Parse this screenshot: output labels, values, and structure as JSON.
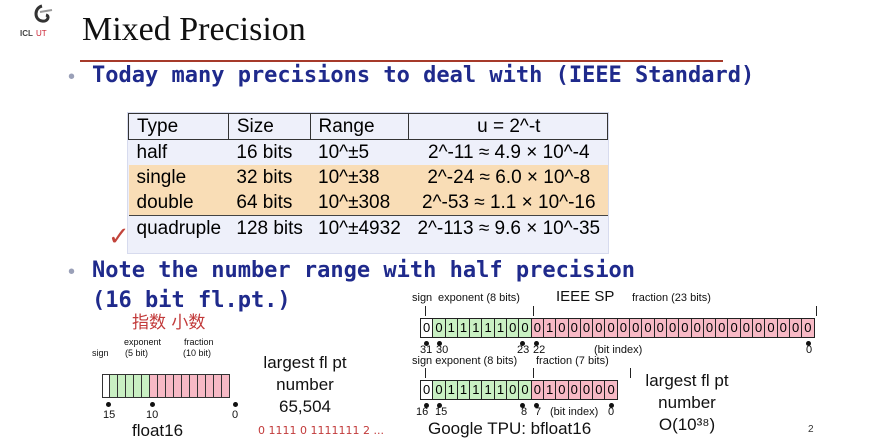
{
  "header": {
    "title": "Mixed Precision"
  },
  "bullets": {
    "b1": "Today many precisions to deal with (IEEE Standard)",
    "b2_line1": "Note the number range with half precision",
    "b2_line2": "(16 bit fl.pt.)"
  },
  "table": {
    "headers": [
      "Type",
      "Size",
      "Range",
      "u = 2^-t"
    ],
    "rows": [
      {
        "type": "half",
        "size": "16 bits",
        "range": "10^±5",
        "u": "2^-11 ≈ 4.9 × 10^-4"
      },
      {
        "type": "single",
        "size": "32 bits",
        "range": "10^±38",
        "u": "2^-24 ≈ 6.0 × 10^-8"
      },
      {
        "type": "double",
        "size": "64 bits",
        "range": "10^±308",
        "u": "2^-53 ≈ 1.1 × 10^-16"
      },
      {
        "type": "quadruple",
        "size": "128 bits",
        "range": "10^±4932",
        "u": "2^-113 ≈ 9.6 × 10^-35"
      }
    ]
  },
  "ieee_sp": {
    "label": "IEEE SP",
    "sign": "sign",
    "exponent": "exponent (8 bits)",
    "fraction": "fraction (23 bits)",
    "bits": "00111110001000000000000000000000",
    "idx_31": "31",
    "idx_30": "30",
    "idx_23": "23",
    "idx_22": "22",
    "idx_0": "0",
    "bit_index": "(bit index)"
  },
  "bfloat16": {
    "sign_exp": "sign  exponent (8 bits)",
    "fraction": "fraction (7 bits)",
    "bits": "0011111000100000",
    "idx_16": "16",
    "idx_15": "15",
    "idx_8": "8",
    "idx_7": "7",
    "idx_0": "0",
    "bit_index": "(bit index)",
    "caption": "Google TPU: bfloat16"
  },
  "float16": {
    "exponent": "exponent",
    "exponent_bits": "(5 bit)",
    "fraction": "fraction",
    "fraction_bits": "(10 bit)",
    "sign": "sign",
    "idx_15": "15",
    "idx_10": "10",
    "idx_0": "0",
    "caption": "float16",
    "largest_line1": "largest fl pt",
    "largest_line2": "number",
    "largest_value": "65,504"
  },
  "bf16_largest": {
    "line1": "largest fl pt",
    "line2": "number",
    "value": "O(10³⁸)"
  },
  "handwriting": {
    "h1": "指数 小数",
    "h2": "0 1111 0 1111111 2 ..."
  },
  "colors": {
    "bullet": "#1f2a8c",
    "rule": "#a63a2a",
    "exp": "#c9f0c3",
    "frac": "#f7b9c5",
    "highlight": "#f9ddb6",
    "table_bg": "#eef0fa"
  },
  "page_number": "2"
}
